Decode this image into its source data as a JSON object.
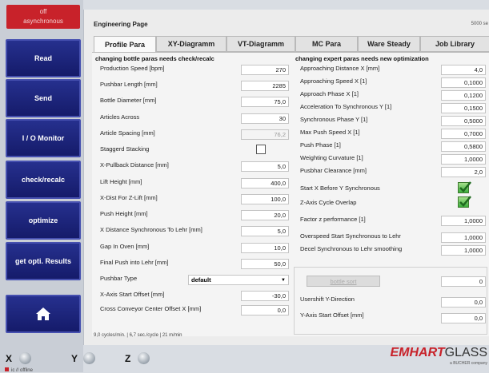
{
  "status": {
    "line1": "off",
    "line2": "asynchronous"
  },
  "sidebar": [
    "Read",
    "Send",
    "I / O Monitor",
    "check/recalc",
    "optimize",
    "get opti. Results"
  ],
  "page": {
    "title": "Engineering Page",
    "right_code": "5000 se"
  },
  "tabs": [
    "Profile Para",
    "XY-Diagramm",
    "VT-Diagramm",
    "MC Para",
    "Ware Steady",
    "Job Library"
  ],
  "left": {
    "heading": "changing bottle paras needs check/recalc",
    "fields": [
      {
        "label": "Production Speed [bpm]",
        "value": "270"
      },
      {
        "label": "Pushbar Length [mm]",
        "value": "2285"
      },
      {
        "label": "Bottle Diameter [mm]",
        "value": "75,0"
      },
      {
        "label": "Articles Across",
        "value": "30"
      },
      {
        "label": "Article Spacing [mm]",
        "value": "76,2"
      },
      {
        "label": "Staggerd Stacking",
        "value": ""
      },
      {
        "label": "X-Pullback Distance [mm]",
        "value": "5,0"
      },
      {
        "label": "Lift Height [mm]",
        "value": "400,0"
      },
      {
        "label": "X-Dist For Z-Lift [mm]",
        "value": "100,0"
      },
      {
        "label": "Push Height [mm]",
        "value": "20,0"
      },
      {
        "label": "X Distance Synchronous To Lehr [mm]",
        "value": "5,0"
      },
      {
        "label": "Gap In Oven [mm]",
        "value": "10,0"
      },
      {
        "label": "Final Push into Lehr [mm]",
        "value": "50,0"
      },
      {
        "label": "Pushbar Type",
        "value": "default"
      },
      {
        "label": "X-Axis Start Offset [mm]",
        "value": "-30,0"
      },
      {
        "label": "Cross Conveyor Center Offset X [mm]",
        "value": "0,0"
      }
    ]
  },
  "right": {
    "heading": "changing expert paras needs new optimization",
    "fields": [
      {
        "label": "Approaching Distance X [mm]",
        "value": "4,0"
      },
      {
        "label": "Approaching Speed X [1]",
        "value": "0,1000"
      },
      {
        "label": "Approach Phase X [1]",
        "value": "0,1200"
      },
      {
        "label": "Acceleration To Synchronous Y [1]",
        "value": "0,1500"
      },
      {
        "label": "Synchronous Phase Y [1]",
        "value": "0,5000"
      },
      {
        "label": "Max Push Speed X [1]",
        "value": "0,7000"
      },
      {
        "label": "Push Phase [1]",
        "value": "0,5800"
      },
      {
        "label": "Weighting Curvature [1]",
        "value": "1,0000"
      },
      {
        "label": "Pusbhar Clearance [mm]",
        "value": "2,0"
      },
      {
        "label": "Start X Before Y Synchronous",
        "value": ""
      },
      {
        "label": "Z-Axis Cycle Overlap",
        "value": ""
      },
      {
        "label": "Factor z performance [1]",
        "value": "1,0000"
      },
      {
        "label": "Overspeed Start Synchronous to Lehr",
        "value": "1,0000"
      },
      {
        "label": "Decel Synchronous to Lehr smoothing",
        "value": "1,0000"
      }
    ],
    "bottle_sort_label": "bottle sort",
    "bottle_sort_value": "0",
    "usershift_label": "Usershift Y-Direction",
    "usershift_value": "0,0",
    "yaxis_label": "Y-Axis Start Offset [mm]",
    "yaxis_value": "0,0"
  },
  "footer_info": "9,0 cycles/min. | 6,7 sec./cycle | 21 m/min",
  "axes": [
    "X",
    "Y",
    "Z"
  ],
  "offline_text": "ic // offline",
  "logo": {
    "brand_em": "EMHART",
    "brand_glass": "GLASS",
    "sub": "a BUCHER company"
  }
}
